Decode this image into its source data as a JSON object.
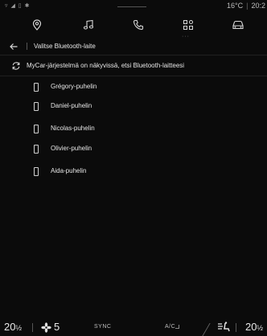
{
  "status_bar": {
    "left_icons": "▿ ◢ ▯ ✱",
    "temperature": "16°C",
    "time": "20:2"
  },
  "nav": {
    "items": [
      {
        "icon": "location-pin-icon"
      },
      {
        "icon": "music-note-icon"
      },
      {
        "icon": "phone-icon"
      },
      {
        "icon": "apps-grid-icon"
      },
      {
        "icon": "car-icon"
      }
    ]
  },
  "title": "Valitse Bluetooth-laite",
  "info": "MyCar-järjestelmä on näkyvissä, etsi Bluetooth-laitteesi",
  "devices": [
    {
      "name": "Grégory-puhelin"
    },
    {
      "name": "Daniel-puhelin"
    },
    {
      "name": "Nicolas-puhelin"
    },
    {
      "name": "Olivier-puhelin"
    },
    {
      "name": "Aida-puhelin"
    }
  ],
  "bottom": {
    "temp_left": "20",
    "temp_left_half": "½",
    "fan_level": "5",
    "sync_label": "SYNC",
    "ac_label": "A/C",
    "temp_right": "20",
    "temp_right_half": "½"
  },
  "colors": {
    "background": "#0b0b0b",
    "text": "#e6e6e6",
    "muted": "#9a9a9a"
  }
}
